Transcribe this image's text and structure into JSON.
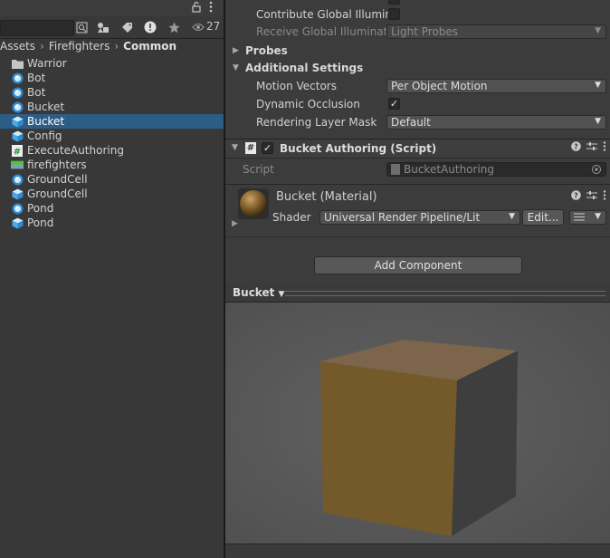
{
  "project": {
    "toolbar": {
      "filter_count": "27"
    },
    "breadcrumb": [
      "Assets",
      "Firefighters",
      "Common"
    ],
    "items": [
      {
        "label": "Warrior",
        "icon": "folder-icon",
        "selected": false
      },
      {
        "label": "Bot",
        "icon": "prefab-variant-icon",
        "selected": false
      },
      {
        "label": "Bot",
        "icon": "prefab-variant-icon",
        "selected": false
      },
      {
        "label": "Bucket",
        "icon": "prefab-variant-icon",
        "selected": false
      },
      {
        "label": "Bucket",
        "icon": "prefab-icon",
        "selected": true
      },
      {
        "label": "Config",
        "icon": "prefab-icon",
        "selected": false
      },
      {
        "label": "ExecuteAuthoring",
        "icon": "script-icon",
        "selected": false
      },
      {
        "label": "firefighters",
        "icon": "terrain-icon",
        "selected": false
      },
      {
        "label": "GroundCell",
        "icon": "prefab-variant-icon",
        "selected": false
      },
      {
        "label": "GroundCell",
        "icon": "prefab-icon",
        "selected": false
      },
      {
        "label": "Pond",
        "icon": "prefab-variant-icon",
        "selected": false
      },
      {
        "label": "Pond",
        "icon": "prefab-icon",
        "selected": false
      }
    ]
  },
  "inspector": {
    "contribute_gi_label": "Contribute Global Illumina",
    "receive_gi_label": "Receive Global Illuminatic",
    "receive_gi_value": "Light Probes",
    "probes_label": "Probes",
    "additional_settings_label": "Additional Settings",
    "motion_vectors_label": "Motion Vectors",
    "motion_vectors_value": "Per Object Motion",
    "dynamic_occlusion_label": "Dynamic Occlusion",
    "dynamic_occlusion_checked": true,
    "rendering_layer_mask_label": "Rendering Layer Mask",
    "rendering_layer_mask_value": "Default",
    "component_title": "Bucket Authoring (Script)",
    "script_label": "Script",
    "script_value": "BucketAuthoring",
    "material_title": "Bucket (Material)",
    "shader_label": "Shader",
    "shader_value": "Universal Render Pipeline/Lit",
    "edit_label": "Edit...",
    "add_component_label": "Add Component",
    "preview_label": "Bucket"
  },
  "colors": {
    "selection": "#2c5d87",
    "cube_front": "#74592a",
    "cube_side": "#3e3e3e",
    "cube_top": "#7c654a",
    "preview_bg": "#5a5a5a"
  }
}
